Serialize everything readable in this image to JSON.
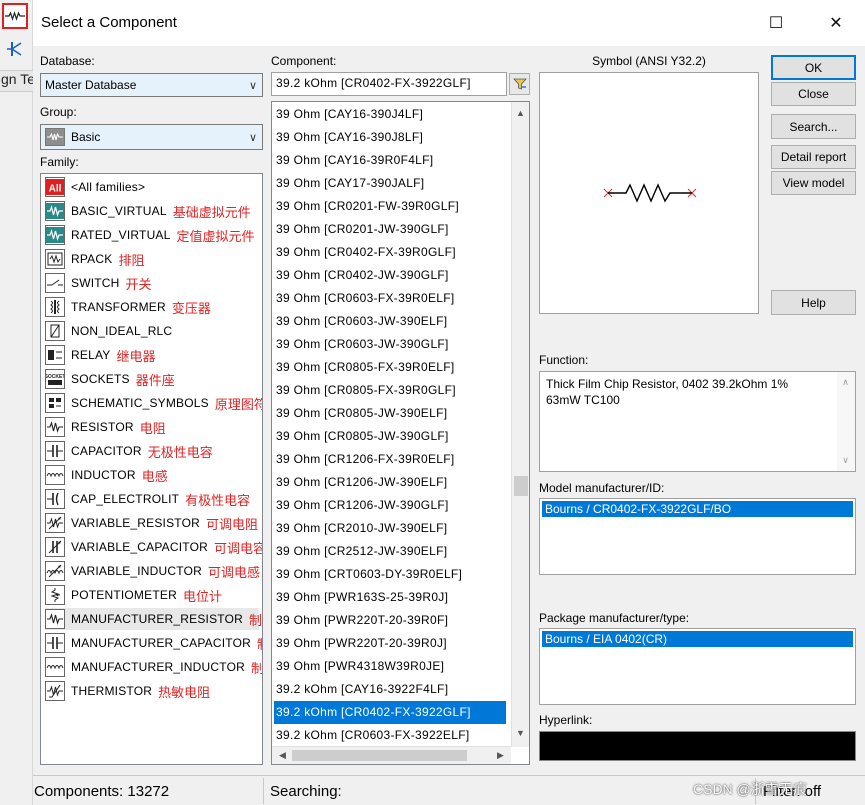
{
  "dialog": {
    "title": "Select a Component",
    "close_glyph": "✕",
    "maximize_glyph": "☐"
  },
  "background_app": {
    "strip_text": "gn Te"
  },
  "database": {
    "label": "Database:",
    "value": "Master Database"
  },
  "group": {
    "label": "Group:",
    "value": "Basic"
  },
  "family": {
    "label": "Family:",
    "items": [
      {
        "name": "<All families>",
        "zh": "",
        "icon": "all-icon"
      },
      {
        "name": "BASIC_VIRTUAL",
        "zh": "基础虚拟元件",
        "icon": "virtual-resistor-icon"
      },
      {
        "name": "RATED_VIRTUAL",
        "zh": "定值虚拟元件",
        "icon": "rated-virtual-icon"
      },
      {
        "name": "RPACK",
        "zh": "排阻",
        "icon": "resistor-pack-icon"
      },
      {
        "name": "SWITCH",
        "zh": "开关",
        "icon": "switch-icon"
      },
      {
        "name": "TRANSFORMER",
        "zh": "变压器",
        "icon": "transformer-icon"
      },
      {
        "name": "NON_IDEAL_RLC",
        "zh": "",
        "icon": "non-ideal-rlc-icon"
      },
      {
        "name": "RELAY",
        "zh": "继电器",
        "icon": "relay-icon"
      },
      {
        "name": "SOCKETS",
        "zh": "器件座",
        "icon": "sockets-icon"
      },
      {
        "name": "SCHEMATIC_SYMBOLS",
        "zh": "原理图符号",
        "icon": "schematic-symbols-icon"
      },
      {
        "name": "RESISTOR",
        "zh": "电阻",
        "icon": "resistor-icon"
      },
      {
        "name": "CAPACITOR",
        "zh": "无极性电容",
        "icon": "capacitor-icon"
      },
      {
        "name": "INDUCTOR",
        "zh": "电感",
        "icon": "inductor-icon"
      },
      {
        "name": "CAP_ELECTROLIT",
        "zh": "有极性电容",
        "icon": "electrolytic-capacitor-icon"
      },
      {
        "name": "VARIABLE_RESISTOR",
        "zh": "可调电阻",
        "icon": "variable-resistor-icon"
      },
      {
        "name": "VARIABLE_CAPACITOR",
        "zh": "可调电容",
        "icon": "variable-capacitor-icon"
      },
      {
        "name": "VARIABLE_INDUCTOR",
        "zh": "可调电感",
        "icon": "variable-inductor-icon"
      },
      {
        "name": "POTENTIOMETER",
        "zh": "电位计",
        "icon": "potentiometer-icon"
      },
      {
        "name": "MANUFACTURER_RESISTOR",
        "zh": "制造商电阻",
        "icon": "manufacturer-resistor-icon"
      },
      {
        "name": "MANUFACTURER_CAPACITOR",
        "zh": "制造商电容",
        "icon": "manufacturer-capacitor-icon"
      },
      {
        "name": "MANUFACTURER_INDUCTOR",
        "zh": "制造商电感",
        "icon": "manufacturer-inductor-icon"
      },
      {
        "name": "THERMISTOR",
        "zh": "热敏电阻",
        "icon": "thermistor-icon"
      }
    ]
  },
  "component": {
    "label": "Component:",
    "value": "39.2 kOhm  [CR0402-FX-3922GLF]",
    "items": [
      "39 Ohm  [CAY16-390J4LF]",
      "39 Ohm  [CAY16-390J8LF]",
      "39 Ohm  [CAY16-39R0F4LF]",
      "39 Ohm  [CAY17-390JALF]",
      "39 Ohm  [CR0201-FW-39R0GLF]",
      "39 Ohm  [CR0201-JW-390GLF]",
      "39 Ohm  [CR0402-FX-39R0GLF]",
      "39 Ohm  [CR0402-JW-390GLF]",
      "39 Ohm  [CR0603-FX-39R0ELF]",
      "39 Ohm  [CR0603-JW-390ELF]",
      "39 Ohm  [CR0603-JW-390GLF]",
      "39 Ohm  [CR0805-FX-39R0ELF]",
      "39 Ohm  [CR0805-FX-39R0GLF]",
      "39 Ohm  [CR0805-JW-390ELF]",
      "39 Ohm  [CR0805-JW-390GLF]",
      "39 Ohm  [CR1206-FX-39R0ELF]",
      "39 Ohm  [CR1206-JW-390ELF]",
      "39 Ohm  [CR1206-JW-390GLF]",
      "39 Ohm  [CR2010-JW-390ELF]",
      "39 Ohm  [CR2512-JW-390ELF]",
      "39 Ohm  [CRT0603-DY-39R0ELF]",
      "39 Ohm  [PWR163S-25-39R0J]",
      "39 Ohm  [PWR220T-20-39R0F]",
      "39 Ohm  [PWR220T-20-39R0J]",
      "39 Ohm  [PWR4318W39R0JE]",
      "39.2 kOhm  [CAY16-3922F4LF]",
      "39.2 kOhm  [CR0402-FX-3922GLF]",
      "39.2 kOhm  [CR0603-FX-3922ELF]"
    ],
    "selected_index": 26
  },
  "symbol": {
    "label": "Symbol (ANSI Y32.2)"
  },
  "buttons": {
    "ok": "OK",
    "close": "Close",
    "search": "Search...",
    "detail_report": "Detail report",
    "view_model": "View model",
    "help": "Help"
  },
  "function": {
    "label": "Function:",
    "text": "Thick Film Chip Resistor, 0402 39.2kOhm 1% 63mW TC100"
  },
  "model_manufacturer": {
    "label": "Model manufacturer/ID:",
    "value": "Bourns / CR0402-FX-3922GLF/BO"
  },
  "package_manufacturer": {
    "label": "Package manufacturer/type:",
    "value": "Bourns / EIA 0402(CR)"
  },
  "hyperlink": {
    "label": "Hyperlink:"
  },
  "status": {
    "components": "Components: 13272",
    "searching": "Searching:",
    "filter": "Filter: off"
  },
  "watermark": "CSDN @浙雪无痕",
  "colors": {
    "selection": "#0078d7",
    "annotation_red": "#e02424",
    "combo_bg": "#e5f1fb",
    "dialog_bg": "#f0f0f0"
  }
}
